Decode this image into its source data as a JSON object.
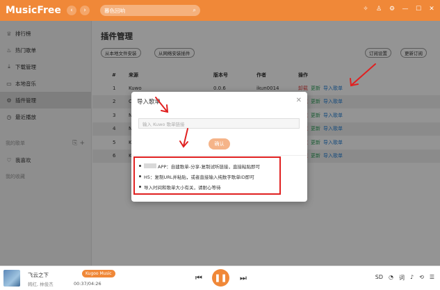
{
  "app": {
    "name": "MusicFree",
    "search_text": "暮色回响",
    "accent": "#f08838"
  },
  "sidebar": {
    "items": [
      {
        "label": "排行榜",
        "icon": "trophy-icon",
        "glyph": "♕"
      },
      {
        "label": "热门歌单",
        "icon": "fire-icon",
        "glyph": "♨"
      },
      {
        "label": "下载管理",
        "icon": "download-icon",
        "glyph": "⤓"
      },
      {
        "label": "本地音乐",
        "icon": "folder-icon",
        "glyph": "▭"
      },
      {
        "label": "插件管理",
        "icon": "plugin-icon",
        "glyph": "⚙"
      },
      {
        "label": "最近播放",
        "icon": "clock-icon",
        "glyph": "◷"
      }
    ],
    "my_playlists_label": "我的歌单",
    "favorites_label": "我喜欢",
    "collected_label": "我的收藏"
  },
  "main": {
    "title": "插件管理",
    "btn_install_local": "从本地文件安装",
    "btn_install_net": "从网络安装插件",
    "btn_subscribe_settings": "订阅设置",
    "btn_update_subscribe": "更新订阅",
    "columns": [
      "#",
      "来源",
      "版本号",
      "作者",
      "操作"
    ],
    "rows": [
      {
        "num": "1",
        "source": "Kuwo",
        "version": "0.0.6",
        "author": "ikun0014"
      },
      {
        "num": "2",
        "source": "C",
        "version": "",
        "author": ""
      },
      {
        "num": "3",
        "source": "N",
        "version": "",
        "author": ""
      },
      {
        "num": "4",
        "source": "N",
        "version": "",
        "author": ""
      },
      {
        "num": "5",
        "source": "K",
        "version": "",
        "author": ""
      },
      {
        "num": "6",
        "source": "K",
        "version": "",
        "author": ""
      }
    ],
    "op_delete": "卸载",
    "op_update": "更新",
    "op_import": "导入歌单"
  },
  "dialog": {
    "title": "导入歌单",
    "input_placeholder": "输入 Kuwo 歌单链接",
    "confirm": "确认",
    "tips": [
      "APP：自建歌单-分享-复制试听链接，直接粘贴即可",
      "H5：复制URL并粘贴，或者直接输入纯数字歌单ID即可",
      "导入时间和歌单大小有关，请耐心等待"
    ]
  },
  "player": {
    "song": "飞云之下",
    "artist": "韩红, 林俊杰",
    "source_badge": "Kugoo Music",
    "time": "00:37/04:26",
    "quality": "SD"
  }
}
